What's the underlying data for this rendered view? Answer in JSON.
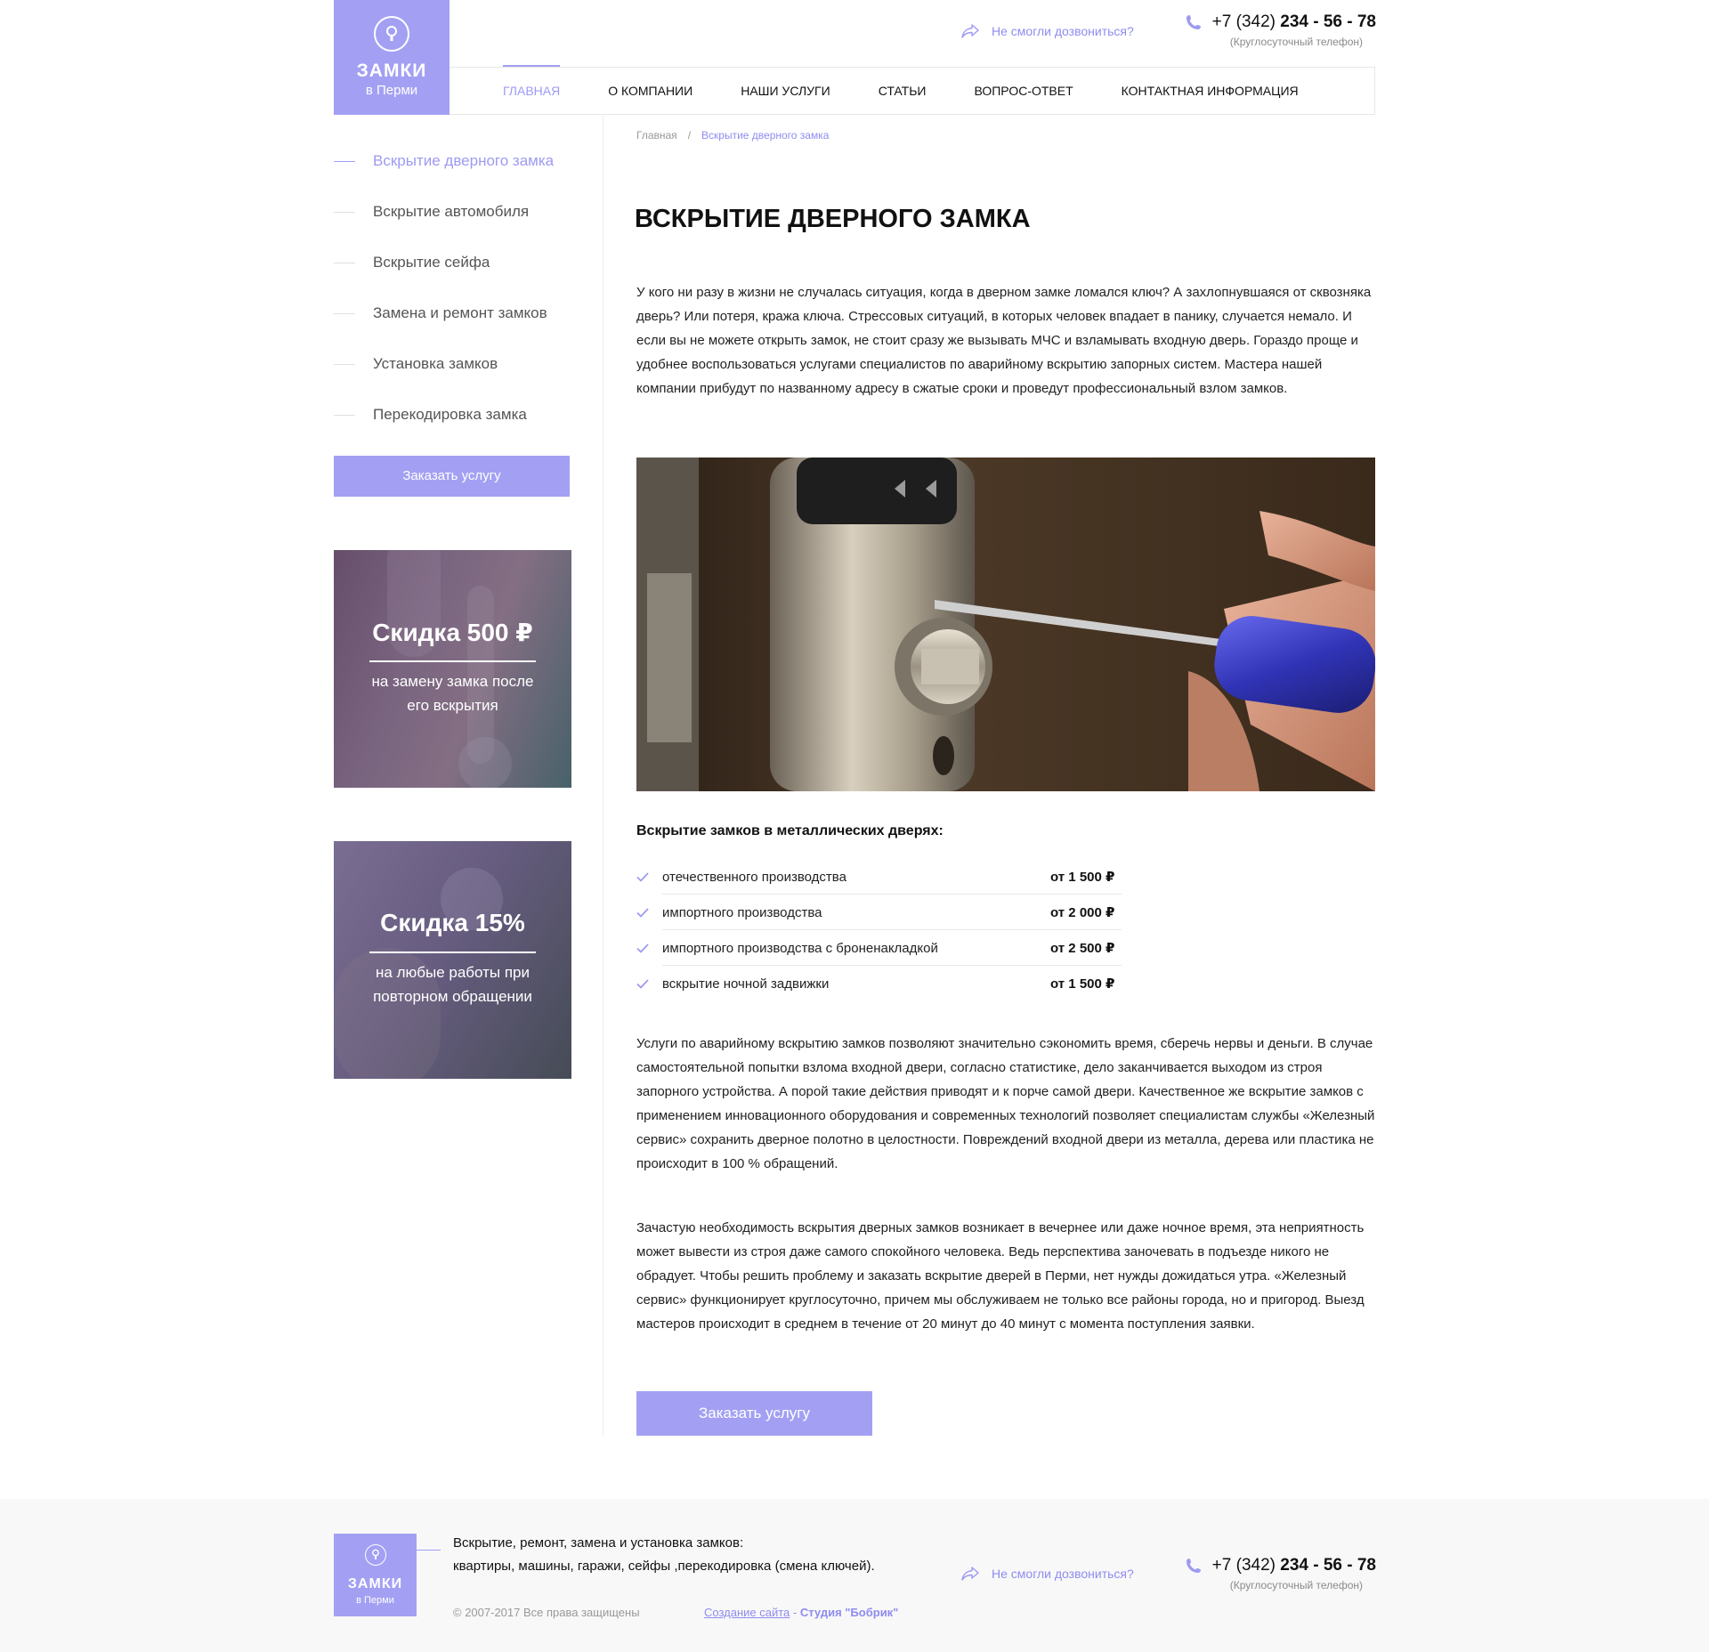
{
  "header": {
    "logo": {
      "title": "ЗАМКИ",
      "subtitle": "в Перми"
    },
    "callback_label": "Не смогли дозвониться?",
    "phone": {
      "prefix": "+7 (342)",
      "number": "234 - 56 - 78",
      "note": "(Круглосуточный телефон)"
    },
    "nav": [
      {
        "label": "Главная",
        "active": true
      },
      {
        "label": "О компании",
        "active": false
      },
      {
        "label": "Наши услуги",
        "active": false
      },
      {
        "label": "Статьи",
        "active": false
      },
      {
        "label": "Вопрос-ответ",
        "active": false
      },
      {
        "label": "Контактная информация",
        "active": false
      }
    ]
  },
  "sidebar": {
    "items": [
      {
        "label": "Вскрытие дверного замка",
        "active": true
      },
      {
        "label": "Вскрытие автомобиля",
        "active": false
      },
      {
        "label": "Вскрытие сейфа",
        "active": false
      },
      {
        "label": "Замена и ремонт замков",
        "active": false
      },
      {
        "label": "Установка замков",
        "active": false
      },
      {
        "label": "Перекодировка замка",
        "active": false
      }
    ],
    "order_button": "Заказать услугу",
    "promos": [
      {
        "title": "Скидка 500 ₽",
        "text": "на замену замка после его вскрытия"
      },
      {
        "title": "Скидка 15%",
        "text": "на любые работы при повторном обращении"
      }
    ]
  },
  "main": {
    "breadcrumb": {
      "home": "Главная",
      "separator": "/",
      "current": "Вскрытие дверного замка"
    },
    "title": "ВСКРЫТИЕ ДВЕРНОГО ЗАМКА",
    "intro": "У кого ни разу в жизни не случалась ситуация, когда в дверном замке ломался ключ? А захлопнувшаяся от сквозняка дверь? Или потеря, кража ключа. Стрессовых ситуаций, в которых человек впадает в панику, случается немало. И если вы не можете открыть замок, не стоит сразу же вызывать МЧС и взламывать входную дверь. Гораздо проще и удобнее воспользоваться услугами специалистов по аварийному вскрытию запорных систем. Мастера нашей компании прибудут по названному адресу в сжатые сроки и проведут профессиональный взлом замков.",
    "subheading": "Вскрытие замков в металлических дверях:",
    "prices": [
      {
        "name": "отечественного производства",
        "value": "от 1 500 ₽"
      },
      {
        "name": "импортного производства",
        "value": "от 2 000 ₽"
      },
      {
        "name": "импортного производства с броненакладкой",
        "value": "от 2 500 ₽"
      },
      {
        "name": "вскрытие ночной задвижки",
        "value": "от 1 500 ₽"
      }
    ],
    "paragraph2": "Услуги по аварийному вскрытию замков позволяют значительно сэкономить время, сберечь нервы и деньги. В случае самостоятельной попытки взлома входной двери, согласно статистике, дело заканчивается выходом из строя запорного устройства. А порой такие действия приводят и к порче самой двери. Качественное же вскрытие замков с применением инновационного оборудования и современных технологий позволяет специалистам службы «Железный сервис» сохранить дверное полотно в целостности. Повреждений входной двери из металла, дерева или пластика не происходит в 100 % обращений.",
    "paragraph3": "Зачастую необходимость вскрытия дверных замков возникает в вечернее или даже ночное время, эта неприятность может вывести из строя даже самого спокойного человека. Ведь перспектива заночевать в подъезде никого не обрадует. Чтобы решить проблему и заказать вскрытие дверей в Перми, нет нужды дожидаться утра. «Железный сервис» функционирует круглосуточно, причем мы обслуживаем не только все районы города, но и пригород. Выезд мастеров происходит в среднем в течение от 20 минут до 40 минут с момента поступления заявки.",
    "order_button": "Заказать услугу"
  },
  "footer": {
    "logo": {
      "title": "ЗАМКИ",
      "subtitle": "в Перми"
    },
    "desc_line1": "Вскрытие, ремонт, замена и установка замков:",
    "desc_line2": "квартиры, машины, гаражи, сейфы ,перекодировка (смена ключей).",
    "copyright": "© 2007-2017 Все права защищены",
    "studio_link": "Создание сайта",
    "studio_dash": " - ",
    "studio_name": "Студия \"Бобрик\"",
    "callback_label": "Не смогли дозвониться?",
    "phone": {
      "prefix": "+7 (342)",
      "number": "234 - 56 - 78",
      "note": "(Круглосуточный телефон)"
    }
  },
  "colors": {
    "accent": "#a3a0f3",
    "accent_text": "#8f8cf0",
    "footer_bg": "#f8f8f8"
  },
  "icons": [
    "keyhole-icon",
    "share-arrow-icon",
    "phone-icon",
    "check-icon"
  ]
}
